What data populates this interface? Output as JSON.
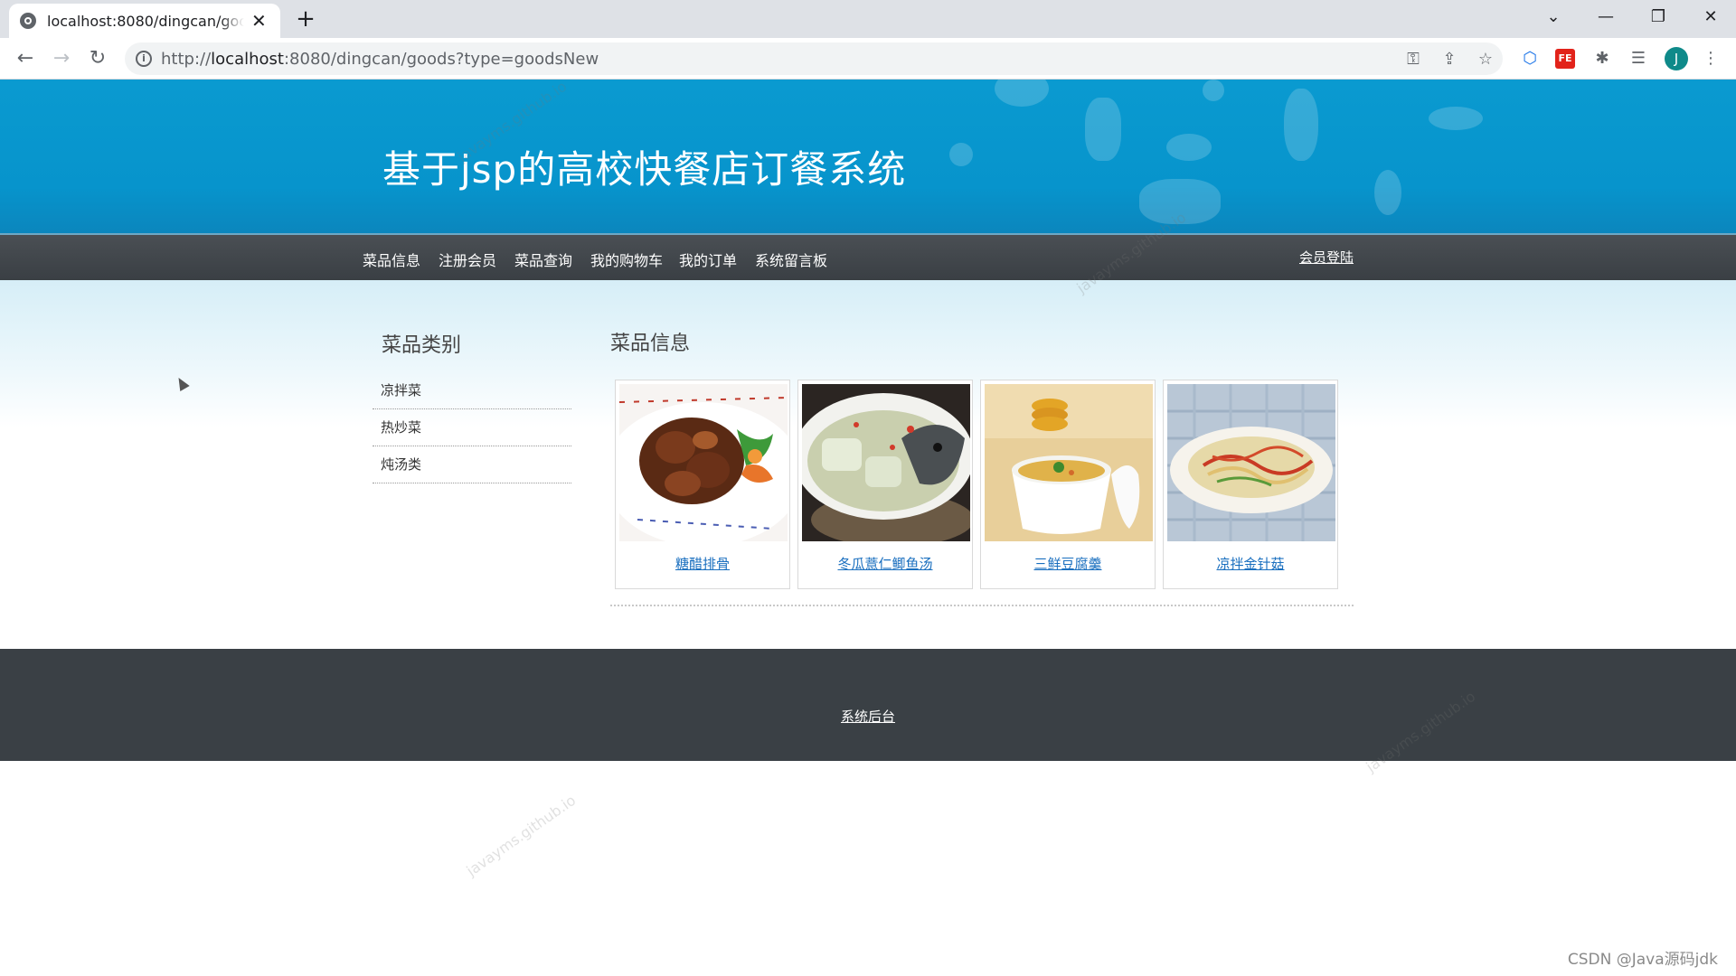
{
  "browser": {
    "tab_title": "localhost:8080/dingcan/goods?type=goodsNew",
    "url_host": "localhost",
    "url_prefix": "http://",
    "url_rest": ":8080/dingcan/goods?type=goodsNew",
    "profile_initial": "J",
    "fe_label": "FE"
  },
  "site": {
    "title": "基于jsp的高校快餐店订餐系统",
    "nav": [
      "菜品信息",
      "注册会员",
      "菜品查询",
      "我的购物车",
      "我的订单",
      "系统留言板"
    ],
    "login": "会员登陆"
  },
  "sidebar": {
    "title": "菜品类别",
    "items": [
      {
        "label": "凉拌菜"
      },
      {
        "label": "热炒菜"
      },
      {
        "label": "炖汤类"
      }
    ]
  },
  "main": {
    "title": "菜品信息",
    "dishes": [
      {
        "name": "糖醋排骨"
      },
      {
        "name": "冬瓜薏仁鲫鱼汤"
      },
      {
        "name": "三鲜豆腐羹"
      },
      {
        "name": "凉拌金针菇"
      }
    ]
  },
  "footer": {
    "link": "系统后台"
  },
  "watermark": "javayms.github.io",
  "credit": "CSDN @Java源码jdk"
}
